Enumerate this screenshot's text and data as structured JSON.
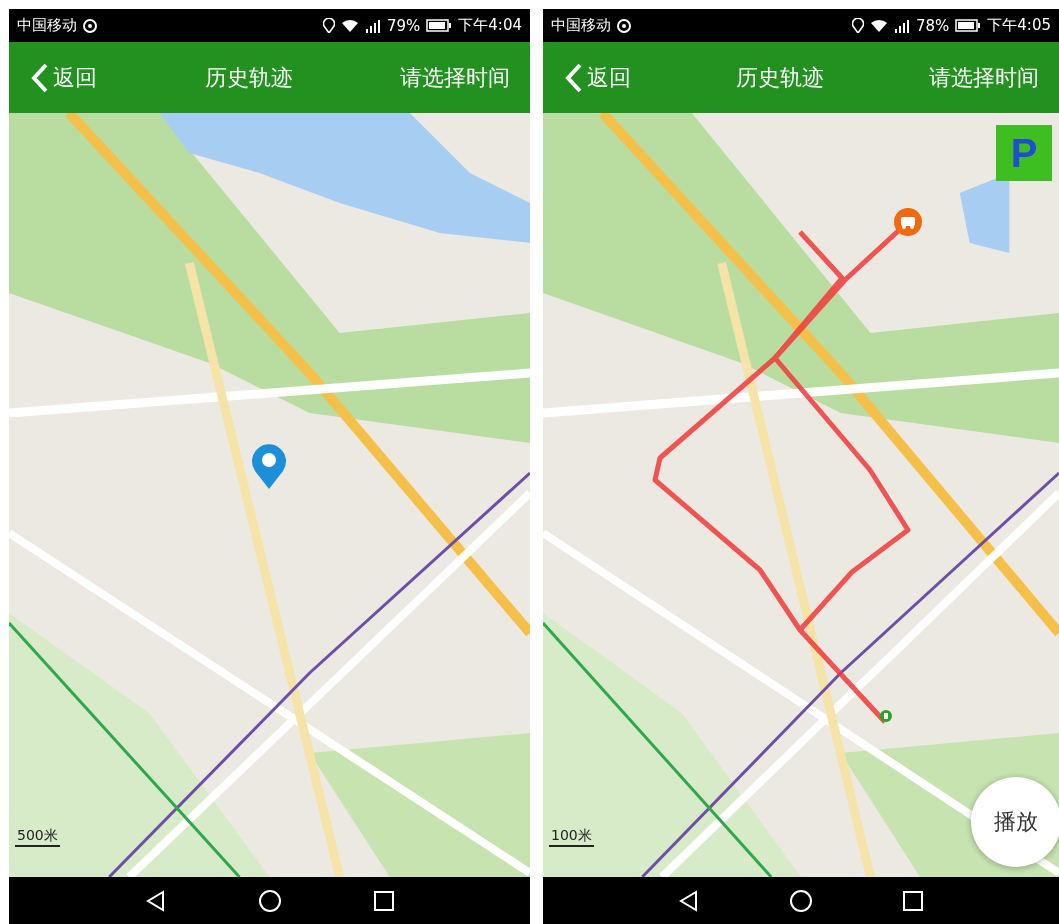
{
  "screens": [
    {
      "status_bar": {
        "carrier": "中国移动",
        "battery": "79%",
        "time": "下午4:04"
      },
      "header": {
        "back": "返回",
        "title": "历史轨迹",
        "action": "请选择时间"
      },
      "map": {
        "kind": "picture",
        "scale": "500米",
        "overlays": [
          {
            "kind": "pin"
          }
        ]
      }
    },
    {
      "status_bar": {
        "carrier": "中国移动",
        "battery": "78%",
        "time": "下午4:05"
      },
      "header": {
        "back": "返回",
        "title": "历史轨迹",
        "action": "请选择时间"
      },
      "map": {
        "kind": "picture",
        "scale": "100米",
        "overlays": [
          {
            "kind": "route"
          },
          {
            "kind": "car"
          },
          {
            "kind": "parking-dot"
          },
          {
            "kind": "parking-badge",
            "label": "P"
          },
          {
            "kind": "play-button",
            "label": "播放"
          }
        ]
      }
    }
  ]
}
